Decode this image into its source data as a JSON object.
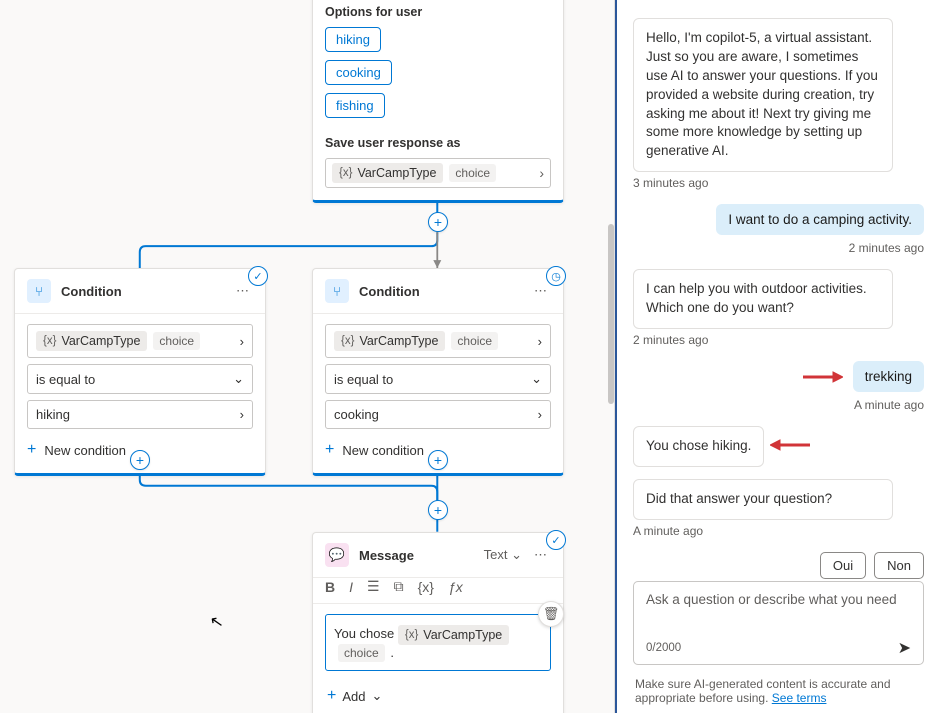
{
  "options_node": {
    "header_label": "Options for user",
    "options": [
      "hiking",
      "cooking",
      "fishing"
    ],
    "save_label": "Save user response as",
    "var_name": "VarCampType",
    "var_type": "choice"
  },
  "condition1": {
    "title": "Condition",
    "var_name": "VarCampType",
    "var_type": "choice",
    "operator": "is equal to",
    "value": "hiking",
    "new_condition": "New condition"
  },
  "condition2": {
    "title": "Condition",
    "var_name": "VarCampType",
    "var_type": "choice",
    "operator": "is equal to",
    "value": "cooking",
    "new_condition": "New condition"
  },
  "message_node": {
    "title": "Message",
    "mode": "Text",
    "prefix": "You chose ",
    "var_name": "VarCampType",
    "var_type": "choice",
    "add_label": "Add"
  },
  "chat": {
    "bot_intro": "Hello, I'm copilot-5, a virtual assistant. Just so you are aware, I sometimes use AI to answer your questions. If you provided a website during creation, try asking me about it! Next try giving me some more knowledge by setting up generative AI.",
    "t1": "3 minutes ago",
    "user1": "I want to do a camping activity.",
    "t2": "2 minutes ago",
    "bot2": "I can help you with outdoor activities. Which one do you want?",
    "t3": "2 minutes ago",
    "user2": "trekking",
    "t4": "A minute ago",
    "bot3": "You chose hiking.",
    "bot4": "Did that answer your question?",
    "t5": "A minute ago",
    "choice_yes": "Oui",
    "choice_no": "Non",
    "placeholder": "Ask a question or describe what you need",
    "counter": "0/2000",
    "footnote_a": "Make sure AI-generated content is accurate and appropriate before using. ",
    "footnote_link": "See terms"
  }
}
